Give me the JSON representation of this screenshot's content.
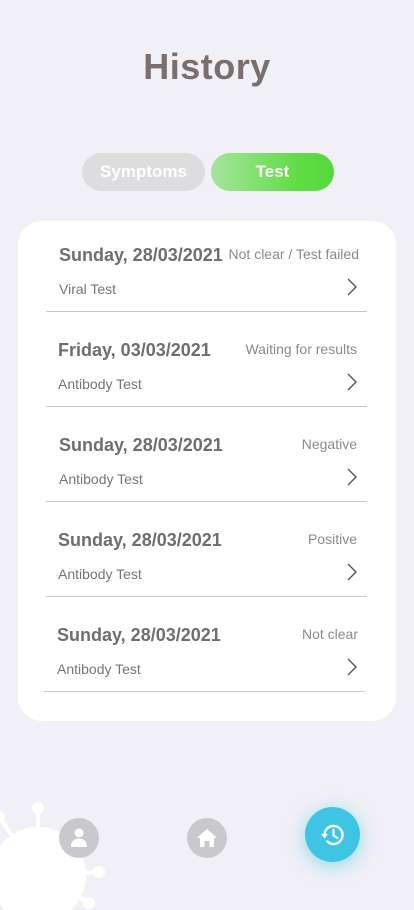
{
  "header": {
    "title": "History"
  },
  "tabs": [
    {
      "label": "Symptoms",
      "active": false
    },
    {
      "label": "Test",
      "active": true
    }
  ],
  "tests": [
    {
      "date": "Sunday, 28/03/2021",
      "status": "Not clear / Test failed",
      "type": "Viral Test"
    },
    {
      "date": "Friday, 03/03/2021",
      "status": "Waiting for results",
      "type": "Antibody Test"
    },
    {
      "date": "Sunday, 28/03/2021",
      "status": "Negative",
      "type": "Antibody Test"
    },
    {
      "date": "Sunday, 28/03/2021",
      "status": "Positive",
      "type": "Antibody Test"
    },
    {
      "date": "Sunday, 28/03/2021",
      "status": "Not clear",
      "type": "Antibody Test"
    }
  ],
  "bottom_nav": {
    "items": [
      {
        "icon": "profile-icon",
        "active": false
      },
      {
        "icon": "home-icon",
        "active": false
      },
      {
        "icon": "history-icon",
        "active": true
      }
    ]
  },
  "colors": {
    "background": "#f1f0f6",
    "title": "#7a6e6e",
    "active_tab": "#55d93b",
    "inactive_tab": "#dddddf",
    "active_nav": "#3ec5e3",
    "inactive_nav": "#c9c8cc"
  }
}
